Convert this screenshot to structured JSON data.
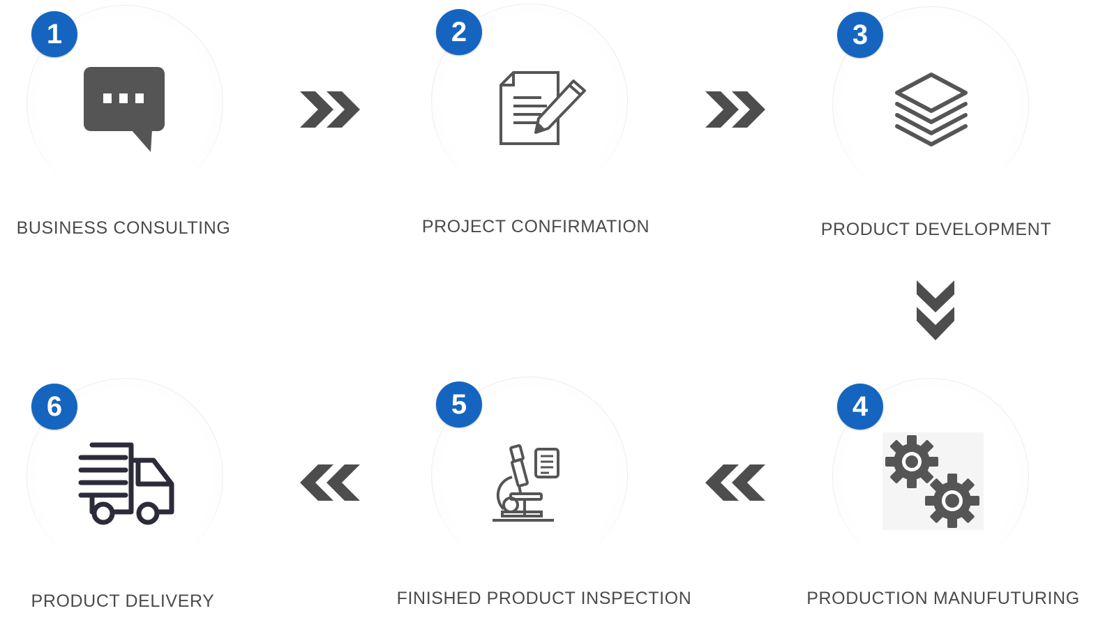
{
  "theme": {
    "badge_color": "#1565c0",
    "icon_color": "#555555",
    "arrow_color": "#4d4d4d"
  },
  "steps": [
    {
      "number": "1",
      "label": "BUSINESS CONSULTING",
      "icon": "chat-bubble-icon"
    },
    {
      "number": "2",
      "label": "PROJECT CONFIRMATION",
      "icon": "document-pencil-icon"
    },
    {
      "number": "3",
      "label": "PRODUCT DEVELOPMENT",
      "icon": "layers-icon"
    },
    {
      "number": "4",
      "label": "PRODUCTION MANUFUTURING",
      "icon": "gears-icon"
    },
    {
      "number": "5",
      "label": "FINISHED PRODUCT INSPECTION",
      "icon": "microscope-icon"
    },
    {
      "number": "6",
      "label": "PRODUCT DELIVERY",
      "icon": "delivery-truck-icon"
    }
  ],
  "arrows": [
    {
      "icon": "double-chevron-right-icon"
    },
    {
      "icon": "double-chevron-right-icon"
    },
    {
      "icon": "double-chevron-down-icon"
    },
    {
      "icon": "double-chevron-left-icon"
    },
    {
      "icon": "double-chevron-left-icon"
    }
  ]
}
